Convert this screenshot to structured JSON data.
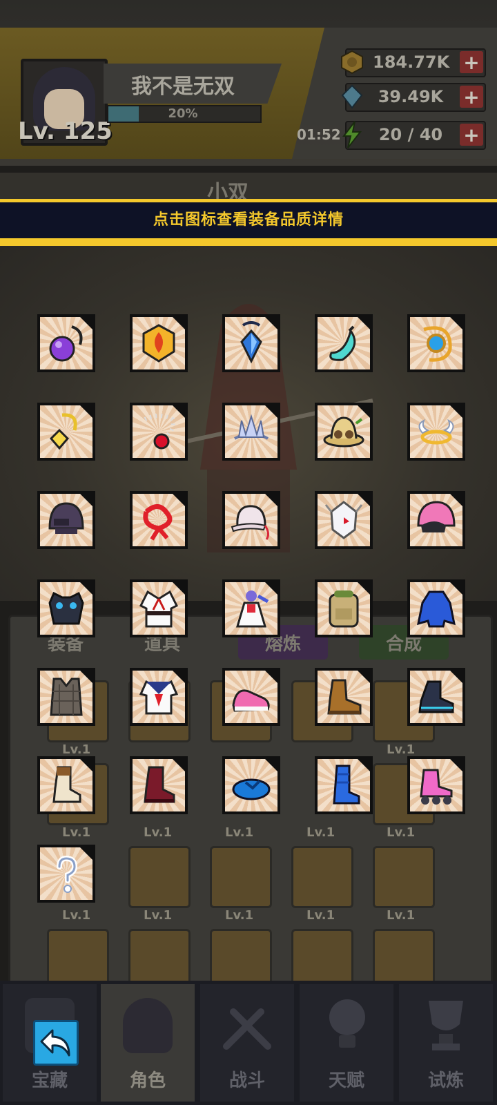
{
  "player": {
    "name": "我不是无双",
    "level_label": "Lv. 125",
    "xp_label": "20%",
    "xp_fraction": 0.2
  },
  "resources": {
    "gold": "184.77K",
    "gems": "39.49K",
    "energy": "20 / 40",
    "energy_timer": "01:52"
  },
  "background": {
    "character_name": "小双",
    "tabs": [
      "装备",
      "道具",
      "熔炼",
      "合成"
    ],
    "tile_level": "Lv.1"
  },
  "banner": {
    "text": "点击图标查看装备品质详情"
  },
  "equipment": [
    {
      "icon": "purple-orb-necklace-icon"
    },
    {
      "icon": "fire-gem-amulet-icon"
    },
    {
      "icon": "blue-crystal-pendant-icon"
    },
    {
      "icon": "cyan-horn-charm-icon"
    },
    {
      "icon": "gold-blue-gem-necklace-icon"
    },
    {
      "icon": "gold-diamond-pendant-icon"
    },
    {
      "icon": "pearl-red-necklace-icon"
    },
    {
      "icon": "ice-crown-tiara-icon"
    },
    {
      "icon": "safari-goggle-hat-icon"
    },
    {
      "icon": "angel-halo-icon"
    },
    {
      "icon": "tactical-helmet-icon"
    },
    {
      "icon": "red-ribbon-icon"
    },
    {
      "icon": "baseball-cap-icon"
    },
    {
      "icon": "white-beast-mask-icon"
    },
    {
      "icon": "pink-motorcycle-helmet-icon"
    },
    {
      "icon": "tech-armor-vest-icon"
    },
    {
      "icon": "karate-gi-icon"
    },
    {
      "icon": "maid-dress-icon"
    },
    {
      "icon": "khaki-backpack-icon"
    },
    {
      "icon": "blue-hoodie-icon"
    },
    {
      "icon": "plaid-tactical-vest-icon"
    },
    {
      "icon": "sailor-uniform-icon"
    },
    {
      "icon": "pink-sneaker-icon"
    },
    {
      "icon": "brown-hiking-boot-icon"
    },
    {
      "icon": "dark-tech-shoe-icon"
    },
    {
      "icon": "lace-up-cream-boot-icon"
    },
    {
      "icon": "maroon-combat-boot-icon"
    },
    {
      "icon": "blue-flip-flop-icon"
    },
    {
      "icon": "blue-tall-boot-icon"
    },
    {
      "icon": "pink-roller-skate-icon"
    },
    {
      "icon": "question-mark-icon"
    }
  ],
  "nav": [
    {
      "label": "宝藏",
      "icon": "back-arrow-icon"
    },
    {
      "label": "角色",
      "icon": "character-portrait-icon"
    },
    {
      "label": "战斗",
      "icon": "crossed-swords-icon"
    },
    {
      "label": "天赋",
      "icon": "lightbulb-icon"
    },
    {
      "label": "试炼",
      "icon": "trophy-icon"
    }
  ],
  "colors": {
    "banner_bg": "#0e1226",
    "banner_accent": "#f4c82c",
    "back_button": "#29a8e3"
  }
}
